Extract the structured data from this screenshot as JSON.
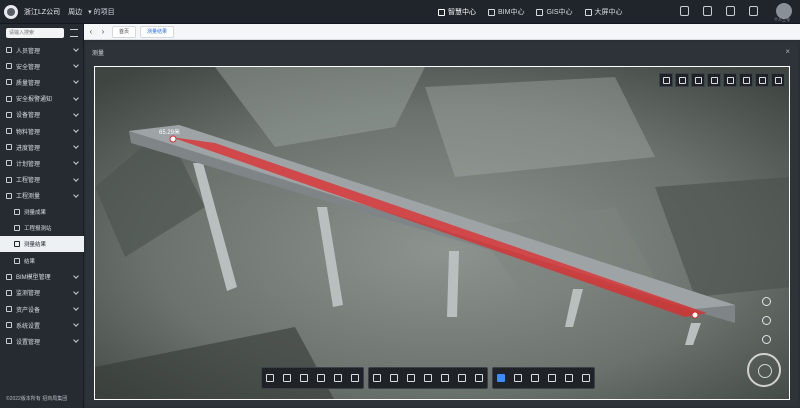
{
  "header": {
    "org": "浙江LZ公司 ",
    "project": "周边",
    "project_selector": "▾ 的项目",
    "modules": [
      {
        "label": "智慧中心",
        "active": true
      },
      {
        "label": "BIM中心",
        "active": false
      },
      {
        "label": "GIS中心",
        "active": false
      },
      {
        "label": "大屏中心",
        "active": false
      }
    ],
    "user": "个人工号"
  },
  "sidebar": {
    "search_placeholder": "请输入搜索",
    "items": [
      {
        "label": "人员管理",
        "type": "group"
      },
      {
        "label": "安全管理",
        "type": "group"
      },
      {
        "label": "质量管理",
        "type": "group"
      },
      {
        "label": "安全报警通知",
        "type": "group"
      },
      {
        "label": "设备管理",
        "type": "group"
      },
      {
        "label": "物料管理",
        "type": "group"
      },
      {
        "label": "进度管理",
        "type": "group"
      },
      {
        "label": "计划管理",
        "type": "group"
      },
      {
        "label": "工程管理",
        "type": "group"
      },
      {
        "label": "工程测量",
        "type": "group"
      },
      {
        "label": "测量成果",
        "type": "sub"
      },
      {
        "label": "工程报测站",
        "type": "sub"
      },
      {
        "label": "测量结果",
        "type": "sub",
        "active": true
      },
      {
        "label": "结果",
        "type": "sub"
      },
      {
        "label": "BIM模型管理",
        "type": "group"
      },
      {
        "label": "监测管理",
        "type": "group"
      },
      {
        "label": "资产设备",
        "type": "group"
      },
      {
        "label": "系统设置",
        "type": "group"
      },
      {
        "label": "设置管理",
        "type": "group"
      }
    ],
    "footer": "©2022版本所有 招商局集团"
  },
  "tabs": [
    {
      "label": "首页",
      "active": false
    },
    {
      "label": "测量结果",
      "active": true
    }
  ],
  "panel": {
    "title": "测量"
  },
  "viewer": {
    "measurement_label": "65.29米",
    "top_tools": [
      "cube-icon",
      "grid-icon",
      "clock-icon",
      "image-icon",
      "flag-icon",
      "box-icon",
      "eye-icon",
      "sun-icon"
    ],
    "right_tools": [
      "globe-icon",
      "refresh-icon",
      "move-icon"
    ],
    "toolbar_groups": [
      [
        "ruler-icon",
        "area-icon",
        "column-icon",
        "pointer-icon",
        "cross-icon",
        "frame-icon"
      ],
      [
        "split-icon",
        "expand-icon",
        "list-icon",
        "calendar-icon",
        "film-icon",
        "triangle-icon",
        "cube-icon"
      ],
      [
        "layer-icon",
        "eye-icon",
        "view-icon",
        "hexagon-icon",
        "text-icon",
        "target-icon"
      ]
    ],
    "active_tool": "layer-icon",
    "accent_color": "#e02a2a"
  }
}
